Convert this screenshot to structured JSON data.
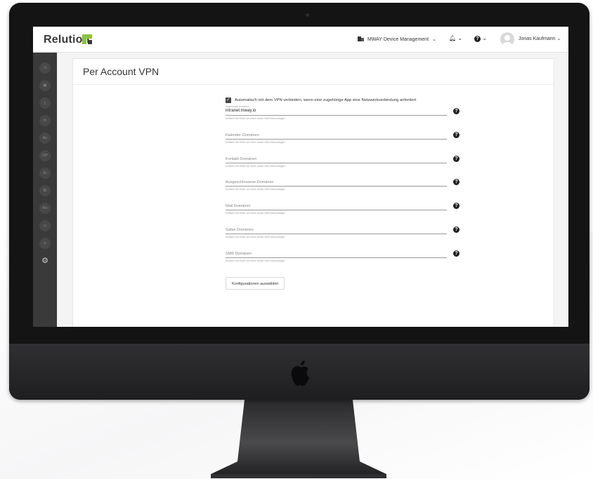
{
  "app": {
    "logo_text": "Relution",
    "organization": "MWAY Device Management",
    "user_name": "Jonas Kaufmann",
    "accent_color": "#8ac33e"
  },
  "sidebar": {
    "items": [
      {
        "label": "",
        "icon": "dashboard-icon"
      },
      {
        "label": "",
        "icon": "grid-icon"
      },
      {
        "label": "",
        "icon": "device-icon"
      },
      {
        "label": "In",
        "icon": "text-badge"
      },
      {
        "label": "Au",
        "icon": "text-badge"
      },
      {
        "label": "DP",
        "icon": "text-badge"
      },
      {
        "label": "Ei",
        "icon": "text-badge"
      },
      {
        "label": "Bi",
        "icon": "text-badge"
      },
      {
        "label": "Re",
        "icon": "text-badge"
      },
      {
        "label": "",
        "icon": "inbox-icon"
      },
      {
        "label": "",
        "icon": "user-icon"
      },
      {
        "label": "",
        "icon": "gear-icon"
      }
    ]
  },
  "page": {
    "title": "Per Account VPN"
  },
  "form": {
    "auto_connect_label": "Automatisch mit dem VPN verbinden, wenn eine zugehörige App eine Netzwerkverbindung anfordert",
    "auto_connect_checked": true,
    "hint": "Drücken Sie Enter um einen neuen Wert hinzuzufügen",
    "fields": [
      {
        "label": "Zugehörige Domänen",
        "value": "intranet.mway.io",
        "placeholder": ""
      },
      {
        "label": "",
        "value": "",
        "placeholder": "Kalender-Domänen"
      },
      {
        "label": "",
        "value": "",
        "placeholder": "Kontakt-Domänen"
      },
      {
        "label": "",
        "value": "",
        "placeholder": "Ausgeschlossene Domänen"
      },
      {
        "label": "",
        "value": "",
        "placeholder": "Mail Domänen"
      },
      {
        "label": "",
        "value": "",
        "placeholder": "Safari Domänen"
      },
      {
        "label": "",
        "value": "",
        "placeholder": "SMB Domänen"
      }
    ],
    "select_button": "Konfigurationen auswählen"
  }
}
